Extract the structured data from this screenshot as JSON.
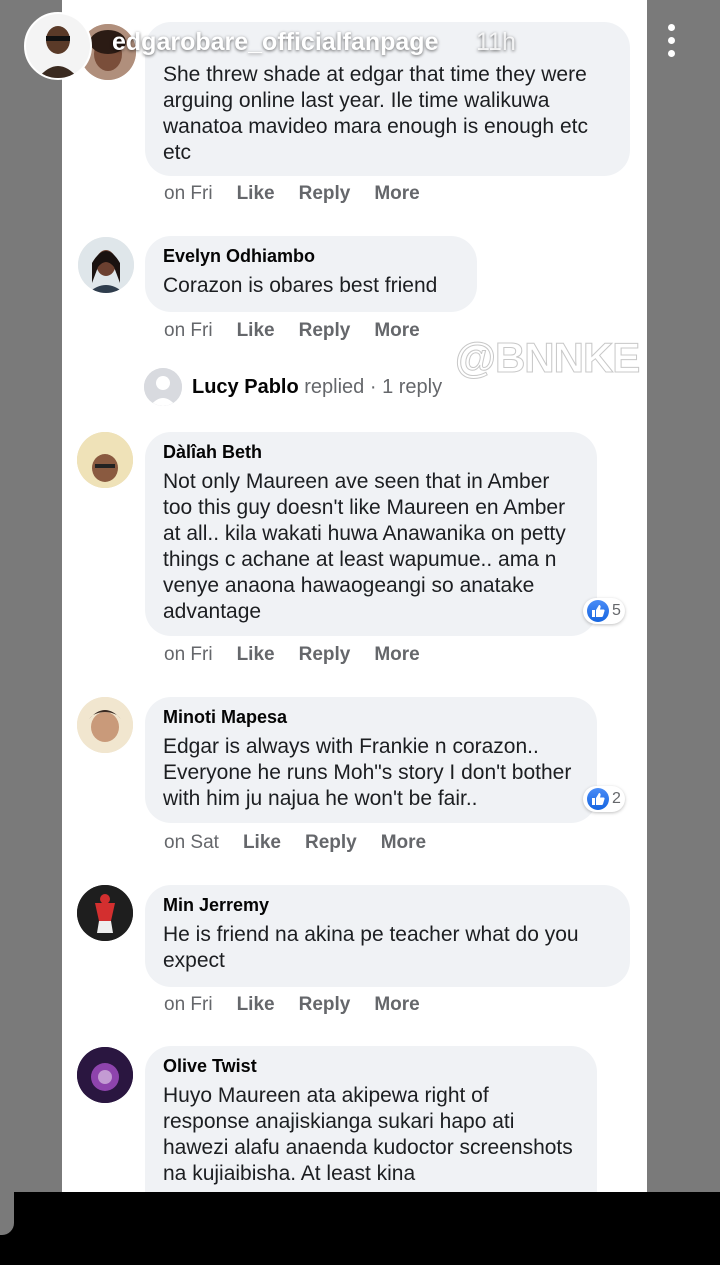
{
  "story": {
    "account_name": "edgarobare_officialfanpage",
    "time_ago": "11h",
    "watermark": "@BNNKE"
  },
  "comments": [
    {
      "name": "",
      "text": "She threw shade at edgar that time they were arguing online last year. Ile time walikuwa wanatoa mavideo mara enough is enough etc etc",
      "time": "on Fri",
      "like": "Like",
      "reply": "Reply",
      "more": "More"
    },
    {
      "name": "Evelyn Odhiambo",
      "text": "Corazon is obares best friend",
      "time": "on Fri",
      "like": "Like",
      "reply": "Reply",
      "more": "More"
    },
    {
      "name": "Dàlîah Beth",
      "text": "Not only Maureen ave seen that in Amber too this guy doesn't like Maureen en Amber at all.. kila wakati huwa Anawanika on petty things c achane at least wapumue.. ama n venye anaona hawaogeangi so anatake advantage",
      "time": "on Fri",
      "like": "Like",
      "reply": "Reply",
      "more": "More",
      "reactions": "5"
    },
    {
      "name": "Minoti Mapesa",
      "text": "Edgar is always with Frankie n corazon.. Everyone he runs Moh\"s story I don't bother with him ju najua he won't be fair..",
      "time": "on Sat",
      "like": "Like",
      "reply": "Reply",
      "more": "More",
      "reactions": "2"
    },
    {
      "name": "Min Jerremy",
      "text": "He is friend na akina pe teacher what do you expect",
      "time": "on Fri",
      "like": "Like",
      "reply": "Reply",
      "more": "More"
    },
    {
      "name": "Olive Twist",
      "text": "Huyo Maureen ata akipewa right of response anajiskianga sukari hapo ati hawezi alafu anaenda kudoctor screenshots na kujiaibisha. At least kina"
    }
  ],
  "reply_summary": {
    "name": "Lucy Pablo",
    "action": "replied",
    "count": "· 1 reply"
  }
}
